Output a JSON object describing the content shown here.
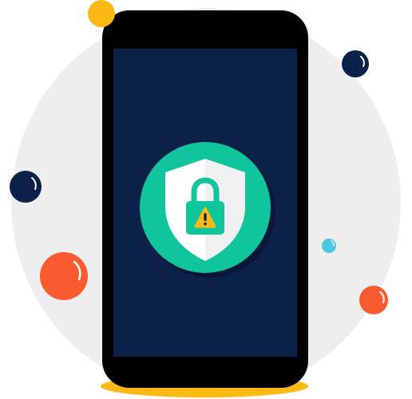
{
  "illustration": {
    "subject": "smartphone-security-warning",
    "icons": [
      "shield-icon",
      "padlock-icon",
      "warning-icon"
    ],
    "colors": {
      "background_circle": "#eeeeee",
      "phone_body": "#000000",
      "phone_screen": "#0b2149",
      "badge_green": "#10c49c",
      "badge_shadow": "#08183a",
      "shield": "#ffffff",
      "warning": "#fcb813",
      "accent_orange": "#fa5a30",
      "accent_navy": "#0b2149",
      "accent_cyan": "#4bc6e0",
      "accent_yellow": "#fcb813"
    }
  }
}
